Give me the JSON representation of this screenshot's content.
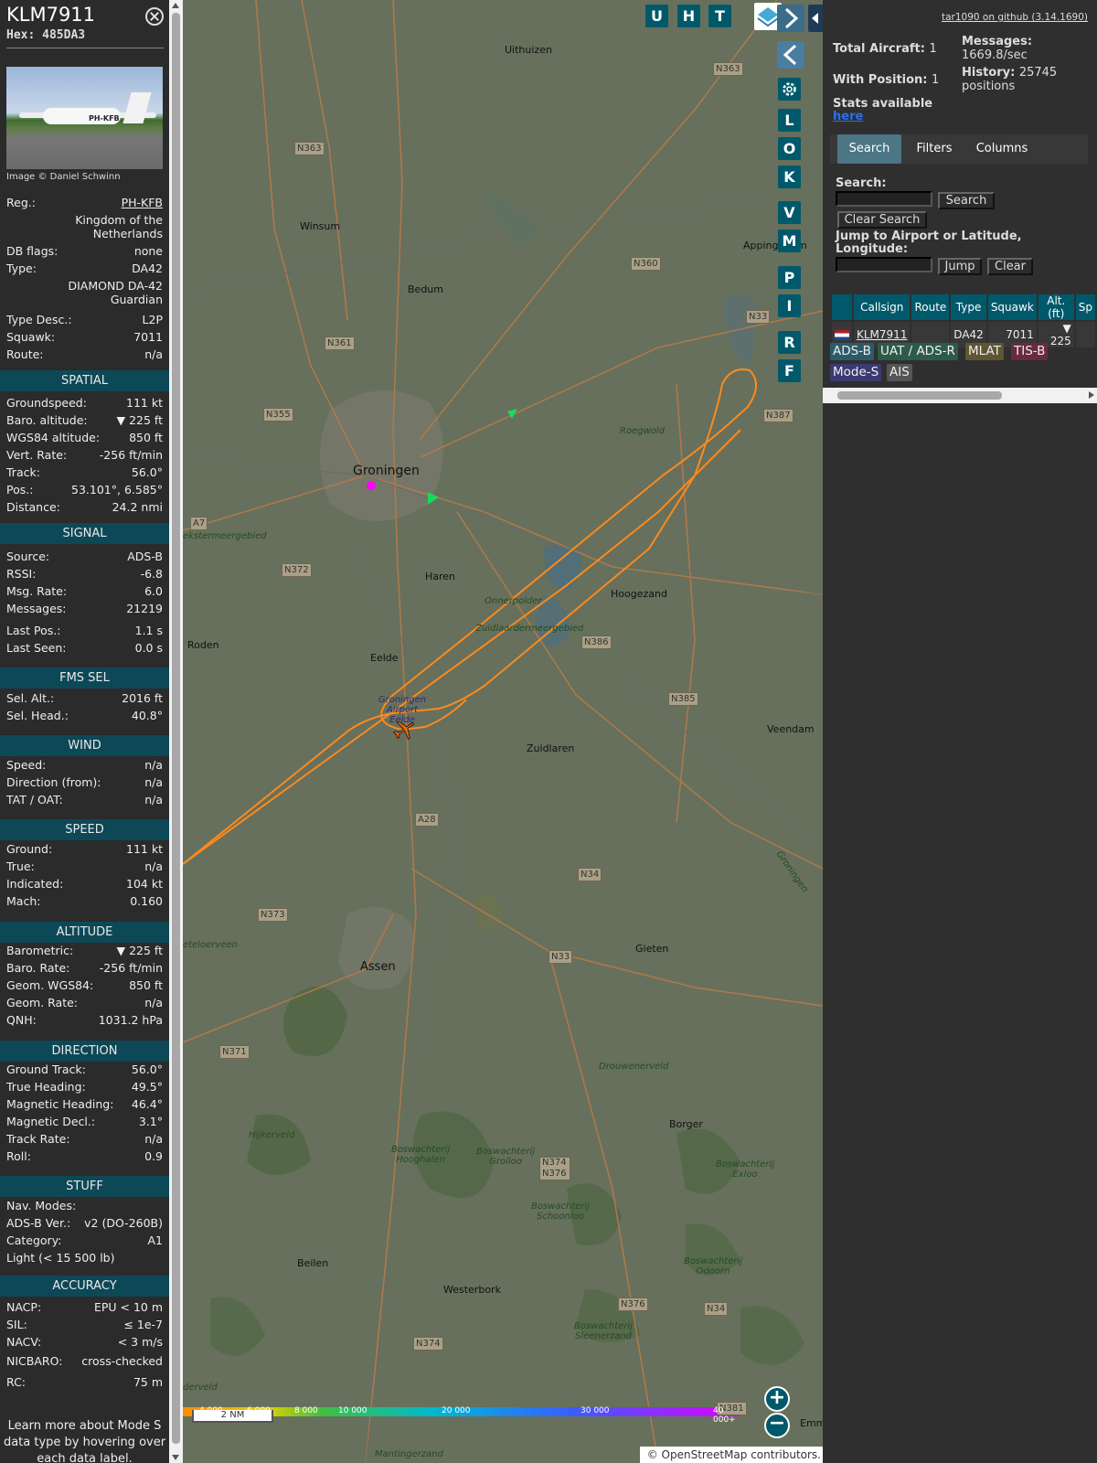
{
  "aircraft": {
    "callsign": "KLM7911",
    "hex_label": "Hex: 485DA3",
    "photo_credit": "Image © Daniel Schwinn",
    "photo_reg": "PH-KFB",
    "reg_label": "Reg.:",
    "reg": "PH-KFB",
    "country": "Kingdom of the Netherlands",
    "dbflags_label": "DB flags:",
    "dbflags": "none",
    "type_label": "Type:",
    "type": "DA42",
    "type_full": "DIAMOND DA-42 Guardian",
    "typedesc_label": "Type Desc.:",
    "typedesc": "L2P",
    "squawk_label": "Squawk:",
    "squawk": "7011",
    "route_label": "Route:",
    "route": "n/a"
  },
  "sections": {
    "spatial": "SPATIAL",
    "signal": "SIGNAL",
    "fms": "FMS SEL",
    "wind": "WIND",
    "speed": "SPEED",
    "altitude": "ALTITUDE",
    "direction": "DIRECTION",
    "stuff": "STUFF",
    "accuracy": "ACCURACY"
  },
  "spatial": [
    {
      "k": "Groundspeed:",
      "v": "111 kt"
    },
    {
      "k": "Baro. altitude:",
      "v": "▼ 225 ft"
    },
    {
      "k": "WGS84 altitude:",
      "v": "850 ft"
    },
    {
      "k": "Vert. Rate:",
      "v": "-256 ft/min"
    },
    {
      "k": "Track:",
      "v": "56.0°"
    },
    {
      "k": "Pos.:",
      "v": "53.101°, 6.585°"
    },
    {
      "k": "Distance:",
      "v": "24.2 nmi"
    }
  ],
  "signal": [
    {
      "k": "Source:",
      "v": "ADS-B"
    },
    {
      "k": "RSSI:",
      "v": "-6.8"
    },
    {
      "k": "Msg. Rate:",
      "v": "6.0"
    },
    {
      "k": "Messages:",
      "v": "21219"
    },
    {
      "k": "Last Pos.:",
      "v": "1.1 s"
    },
    {
      "k": "Last Seen:",
      "v": "0.0 s"
    }
  ],
  "fms": [
    {
      "k": "Sel. Alt.:",
      "v": "2016 ft"
    },
    {
      "k": "Sel. Head.:",
      "v": "40.8°"
    }
  ],
  "wind": [
    {
      "k": "Speed:",
      "v": "n/a"
    },
    {
      "k": "Direction (from):",
      "v": "n/a"
    },
    {
      "k": "TAT / OAT:",
      "v": "n/a"
    }
  ],
  "speed": [
    {
      "k": "Ground:",
      "v": "111 kt"
    },
    {
      "k": "True:",
      "v": "n/a"
    },
    {
      "k": "Indicated:",
      "v": "104 kt"
    },
    {
      "k": "Mach:",
      "v": "0.160"
    }
  ],
  "altitude": [
    {
      "k": "Barometric:",
      "v": "▼ 225 ft"
    },
    {
      "k": "Baro. Rate:",
      "v": "-256 ft/min"
    },
    {
      "k": "Geom. WGS84:",
      "v": "850 ft"
    },
    {
      "k": "Geom. Rate:",
      "v": "n/a"
    },
    {
      "k": "QNH:",
      "v": "1031.2 hPa"
    }
  ],
  "direction": [
    {
      "k": "Ground Track:",
      "v": "56.0°"
    },
    {
      "k": "True Heading:",
      "v": "49.5°"
    },
    {
      "k": "Magnetic Heading:",
      "v": "46.4°"
    },
    {
      "k": "Magnetic Decl.:",
      "v": "3.1°"
    },
    {
      "k": "Track Rate:",
      "v": "n/a"
    },
    {
      "k": "Roll:",
      "v": "0.9"
    }
  ],
  "stuff": [
    {
      "k": "Nav. Modes:",
      "v": ""
    },
    {
      "k": "ADS-B Ver.:",
      "v": "v2 (DO-260B)"
    },
    {
      "k": "Category:",
      "v": "A1"
    },
    {
      "k": "Light (< 15 500 lb)",
      "v": ""
    }
  ],
  "accuracy": [
    {
      "k": "NACP:",
      "v": "EPU < 10 m"
    },
    {
      "k": "SIL:",
      "v": "≤ 1e-7"
    },
    {
      "k": "NACV:",
      "v": "< 3 m/s"
    },
    {
      "k": "NICBARO:",
      "v": "cross-checked"
    },
    {
      "k": "RC:",
      "v": "75 m"
    }
  ],
  "footer_note": "Learn more about Mode S data type by hovering over each data label.",
  "map": {
    "toolbar_top": [
      "U",
      "H",
      "T"
    ],
    "toolbar_side": [
      "L",
      "O",
      "K",
      "V",
      "M",
      "P",
      "I",
      "R",
      "F"
    ],
    "scale_bar": "2 NM",
    "attribution": "© OpenStreetMap contributors.",
    "alt_ticks": [
      "4 000",
      "6 000",
      "8 000",
      "10 000",
      "20 000",
      "30 000",
      "40 000+"
    ],
    "places": [
      {
        "name": "Uithuizen"
      },
      {
        "name": "Winsum"
      },
      {
        "name": "Bedum"
      },
      {
        "name": "Appingedam"
      },
      {
        "name": "Groningen"
      },
      {
        "name": "Haren"
      },
      {
        "name": "Hoogezand"
      },
      {
        "name": "Roden"
      },
      {
        "name": "Eelde"
      },
      {
        "name": "Zuidlaren"
      },
      {
        "name": "Veendam"
      },
      {
        "name": "Assen"
      },
      {
        "name": "Gieten"
      },
      {
        "name": "Borger"
      },
      {
        "name": "Beilen"
      },
      {
        "name": "Westerbork"
      },
      {
        "name": "Emm"
      }
    ],
    "roads": [
      "N363",
      "N363",
      "N360",
      "N361",
      "N355",
      "N33",
      "N387",
      "A7",
      "N372",
      "N386",
      "N385",
      "A28",
      "N34",
      "N373",
      "N33",
      "N371",
      "N374 N376",
      "N376",
      "N34",
      "N374",
      "N381"
    ],
    "areas": [
      "Roegwold",
      "Onnerpolder",
      "Zuidlaardermeergebied",
      "Groningen Airport Eelde",
      "Drouwenerveld",
      "Hijkerveld",
      "Boswachterij Hooghalen",
      "Boswachterij Grolloo",
      "Boswachterij Schoonloo",
      "Boswachterij Exloo",
      "Boswachterij Odoorn",
      "Boswachterij Sleenerzand",
      "Mantingerzand",
      "ekstermeergebied",
      "eteloerveen",
      "derveld",
      "Groningen"
    ]
  },
  "right": {
    "github": "tar1090 on github (3.14.1690)",
    "total_label": "Total Aircraft:",
    "total": "1",
    "withpos_label": "With Position:",
    "withpos": "1",
    "messages_label": "Messages:",
    "messages": "1669.8/sec",
    "history_label": "History:",
    "history": "25745 positions",
    "stats_label": "Stats available",
    "stats_link": "here",
    "tabs": [
      "Search",
      "Filters",
      "Columns"
    ],
    "search_label": "Search:",
    "search_btn": "Search",
    "clear_search_btn": "Clear Search",
    "jump_label": "Jump to Airport or Latitude, Longitude:",
    "jump_btn": "Jump",
    "clear_btn": "Clear",
    "table_headers": [
      "Callsign",
      "Route",
      "Type",
      "Squawk",
      "Alt. (ft)",
      "Sp"
    ],
    "table_rows": [
      {
        "callsign": "KLM7911",
        "route": "",
        "type": "DA42",
        "squawk": "7011",
        "alt": "▼ 225"
      }
    ],
    "sources": [
      "ADS-B",
      "UAT / ADS-R",
      "MLAT",
      "TIS-B",
      "Mode-S",
      "AIS"
    ]
  },
  "colors": {
    "section_bg": "#0d4857",
    "button_bg": "#00596b",
    "track": "#ff8a1c",
    "src_adsb": "#2d5a6b",
    "src_uat": "#2d5a4a",
    "src_mlat": "#5f5531",
    "src_tisb": "#6a2a40",
    "src_modes": "#3b3a72",
    "src_ais": "#555555"
  }
}
